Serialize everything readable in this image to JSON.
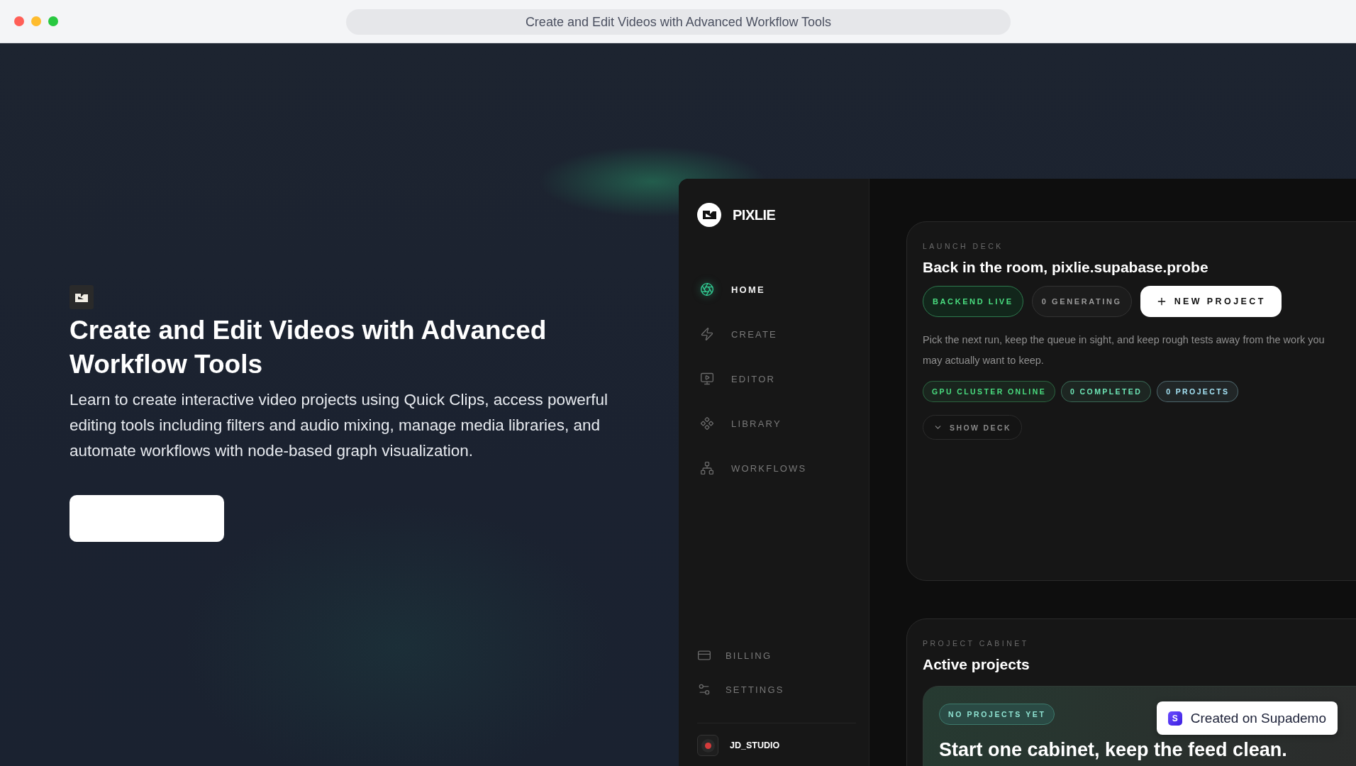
{
  "window": {
    "title": "Create and Edit Videos with Advanced Workflow Tools"
  },
  "intro": {
    "heading": "Create and Edit Videos with Advanced Workflow Tools",
    "body": "Learn to create interactive video projects using Quick Clips, access powerful editing tools including filters and audio mixing, manage media libraries, and automate workflows with node-based graph visualization."
  },
  "app": {
    "brand": "PIXLIE",
    "nav": [
      {
        "label": "HOME",
        "kind": "aperture",
        "selected": true
      },
      {
        "label": "CREATE",
        "kind": "bolt",
        "selected": false
      },
      {
        "label": "EDITOR",
        "kind": "monitor",
        "selected": false
      },
      {
        "label": "LIBRARY",
        "kind": "diamonds",
        "selected": false
      },
      {
        "label": "WORKFLOWS",
        "kind": "network",
        "selected": false
      }
    ],
    "footer_nav": [
      {
        "label": "BILLING",
        "kind": "card"
      },
      {
        "label": "SETTINGS",
        "kind": "sliders"
      }
    ],
    "user": {
      "name": "JD_STUDIO"
    }
  },
  "launch_deck": {
    "eyebrow": "LAUNCH DECK",
    "title": "Back in the room, pixlie.supabase.probe",
    "pills": [
      {
        "label": "BACKEND LIVE",
        "kind": "live"
      },
      {
        "label": "0 GENERATING",
        "kind": "count"
      }
    ],
    "new_button": "NEW PROJECT",
    "description": "Pick the next run, keep the queue in sight, and keep rough tests away from the work you may actually want to keep.",
    "chips": [
      {
        "label": "GPU CLUSTER ONLINE",
        "color": "#4ade80"
      },
      {
        "label": "0 COMPLETED",
        "color": "#6ee7b7"
      },
      {
        "label": "0 PROJECTS",
        "color": "#a5e3f5"
      }
    ],
    "toggle": {
      "label": "SHOW DECK",
      "expanded": false
    }
  },
  "cabinet": {
    "eyebrow": "PROJECT CABINET",
    "title": "Active projects",
    "empty_badge": "NO PROJECTS YET",
    "empty_title": "Start one cabinet, keep the feed clean."
  },
  "badge": {
    "logo": "S",
    "label": "Created on Supademo"
  }
}
